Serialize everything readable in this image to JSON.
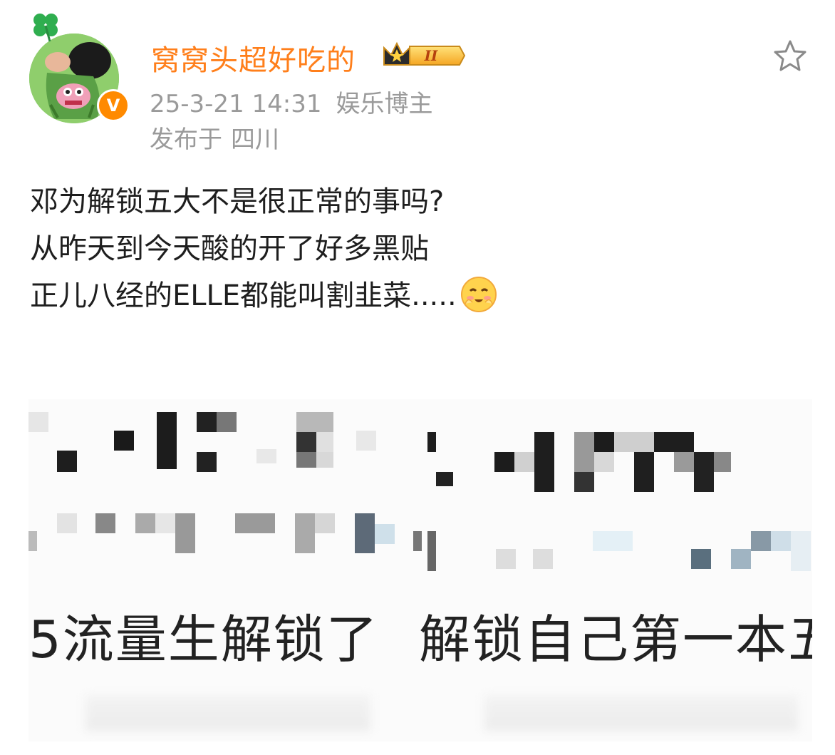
{
  "author": {
    "name": "窝窝头超好吃的",
    "vip_level": "II",
    "verified_mark": "V",
    "avatar_icon": "cartoon-avatar-icon",
    "clover_icon": "four-leaf-clover-icon"
  },
  "meta": {
    "date": "25-3-21 14:31",
    "role": "娱乐博主",
    "location_prefix": "发布于",
    "location": "四川"
  },
  "actions": {
    "favorite_icon": "star-outline-icon"
  },
  "post": {
    "lines": [
      "邓为解锁五大不是很正常的事吗?",
      "从昨天到今天酸的开了好多黑贴",
      "正儿八经的ELLE都能叫割韭菜....."
    ],
    "emoji_icon": "shy-smile-emoji-icon"
  },
  "image": {
    "caption_left": "5流量生解锁了",
    "caption_right": "解锁自己第一本五"
  },
  "colors": {
    "username": "#ff7f1b",
    "meta": "#9a9a9a",
    "verify_badge": "#ff8a00",
    "text": "#1e1e1e"
  }
}
